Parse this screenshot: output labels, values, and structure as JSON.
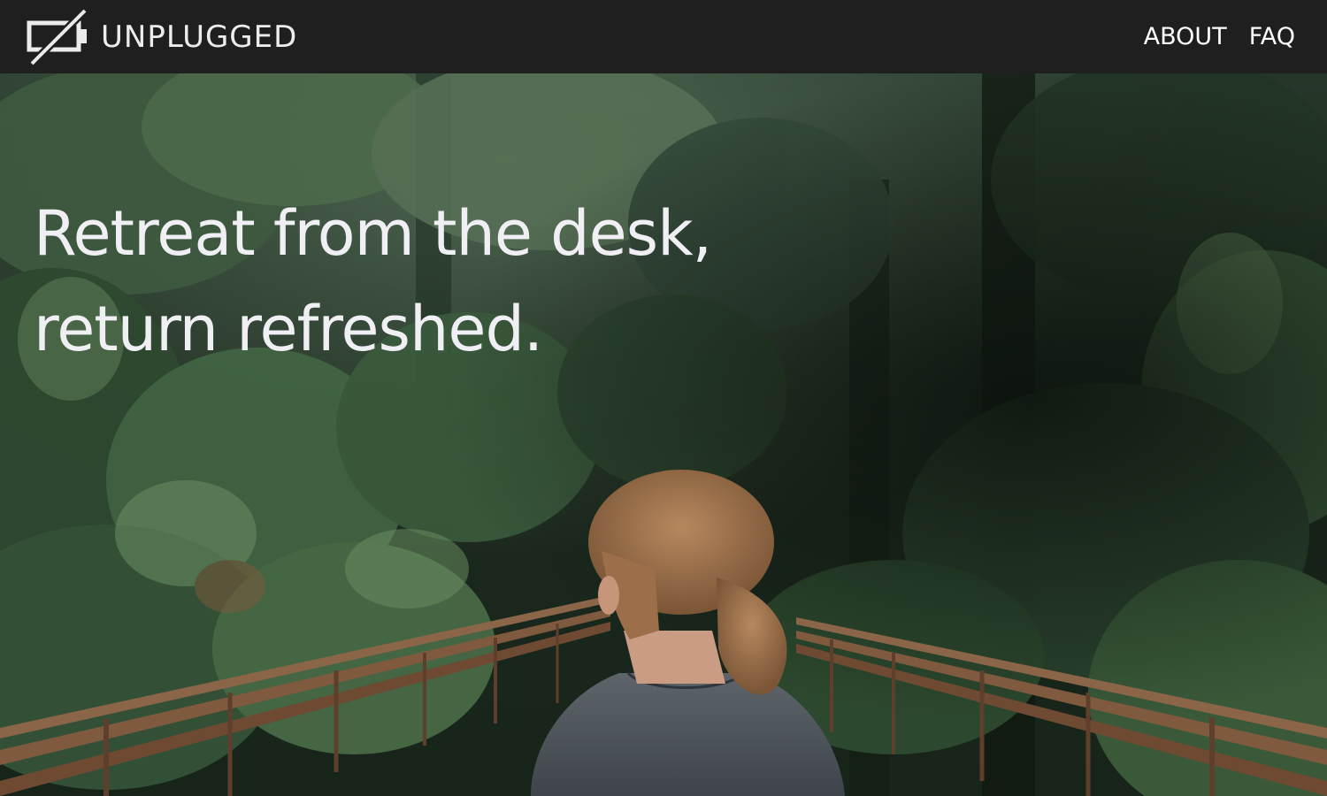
{
  "brand": {
    "name": "UNPLUGGED",
    "logo_icon": "unplugged-logo-icon"
  },
  "nav": {
    "items": [
      {
        "label": "ABOUT"
      },
      {
        "label": "FAQ"
      }
    ]
  },
  "hero": {
    "headline_line_1": "Retreat from the desk,",
    "headline_line_2": "return refreshed.",
    "photo": "forest-bridge-woman-photo"
  },
  "colors": {
    "navbar_bg": "#1f1f1f",
    "nav_text": "#ffffff",
    "headline_text": "#efeff4"
  }
}
